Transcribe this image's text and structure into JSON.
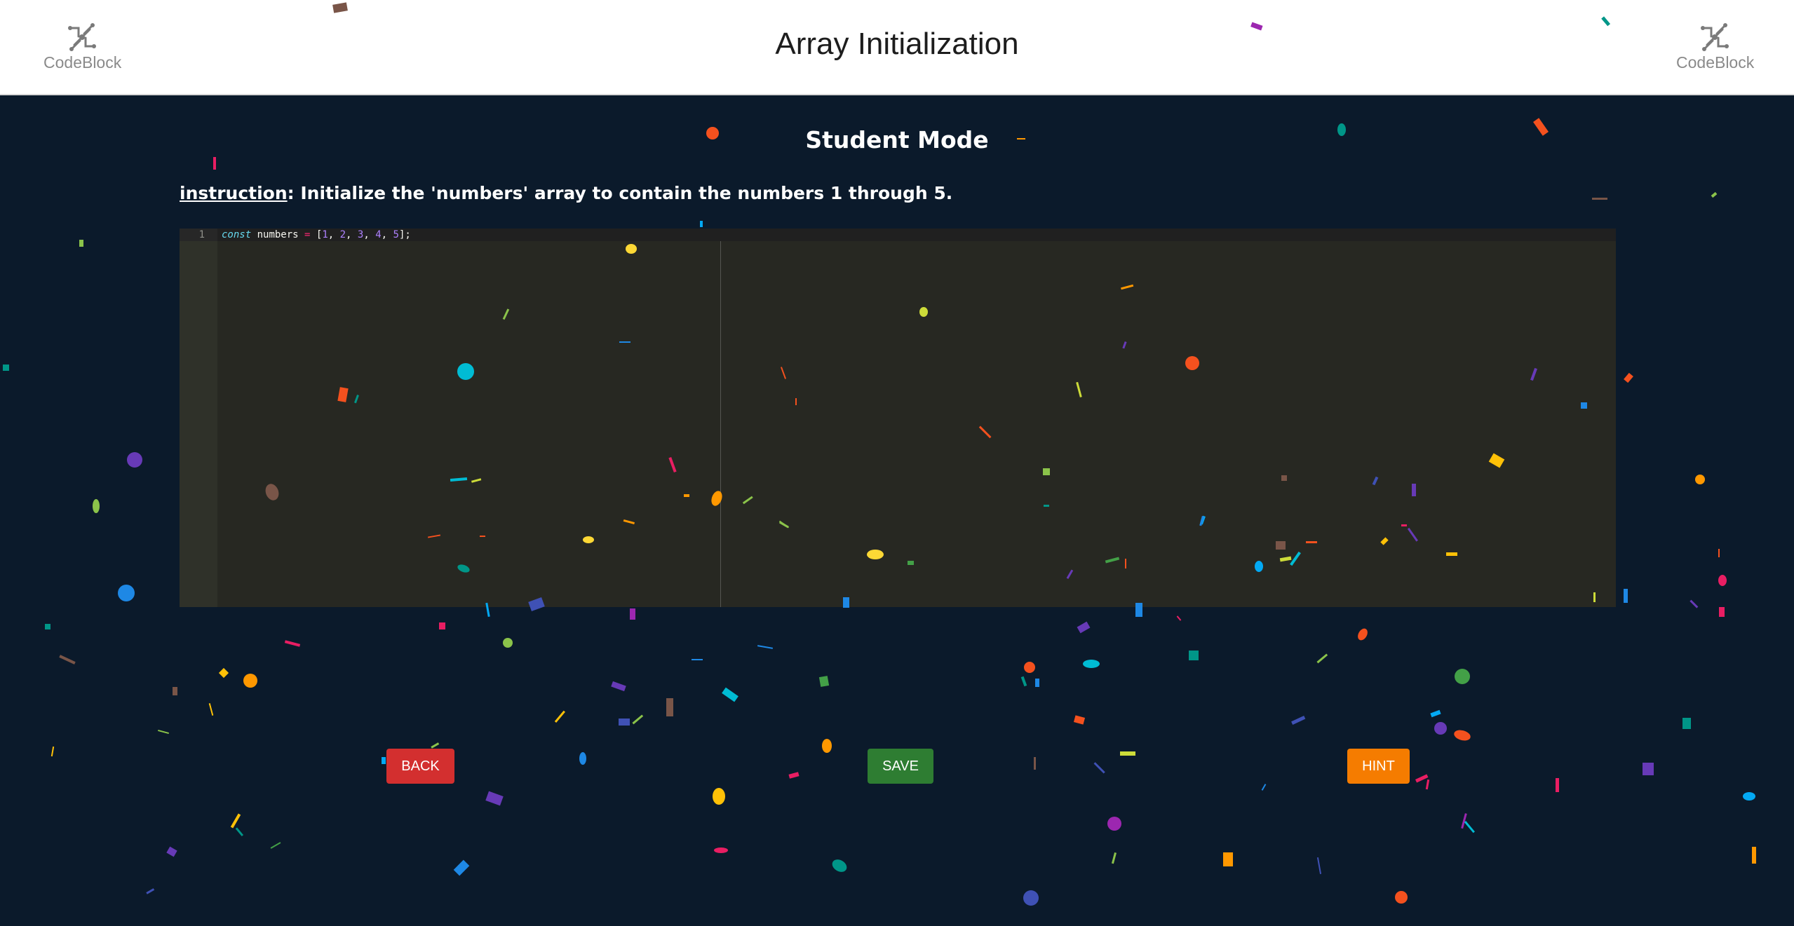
{
  "header": {
    "title": "Array Initialization",
    "logo_text": "CodeBlock",
    "logo_icon": "codeblock-logo-icon"
  },
  "mode_title": "Student Mode",
  "instruction": {
    "label": "instruction",
    "text": ": Initialize the 'numbers' array to contain the numbers 1 through 5."
  },
  "editor": {
    "line_number": "1",
    "code": {
      "keyword": "const",
      "identifier": " numbers ",
      "operator": "=",
      "open": " [",
      "n1": "1",
      "n2": "2",
      "n3": "3",
      "n4": "4",
      "n5": "5",
      "sep": ", ",
      "close": "];"
    }
  },
  "buttons": {
    "back": "BACK",
    "save": "SAVE",
    "hint": "HINT"
  },
  "colors": {
    "background": "#0b1a2b",
    "editor_bg": "#272822",
    "back": "#d32f2f",
    "save": "#2e7d32",
    "hint": "#f57c00"
  },
  "decorations": {
    "confetti_colors": [
      "#f4511e",
      "#fdd835",
      "#00bcd4",
      "#673ab7",
      "#1e88e5",
      "#43a047",
      "#e91e63",
      "#8bc34a",
      "#ff9800",
      "#795548",
      "#9c27b0",
      "#3f51b5",
      "#cddc39",
      "#009688",
      "#03a9f4",
      "#ffc107"
    ]
  }
}
